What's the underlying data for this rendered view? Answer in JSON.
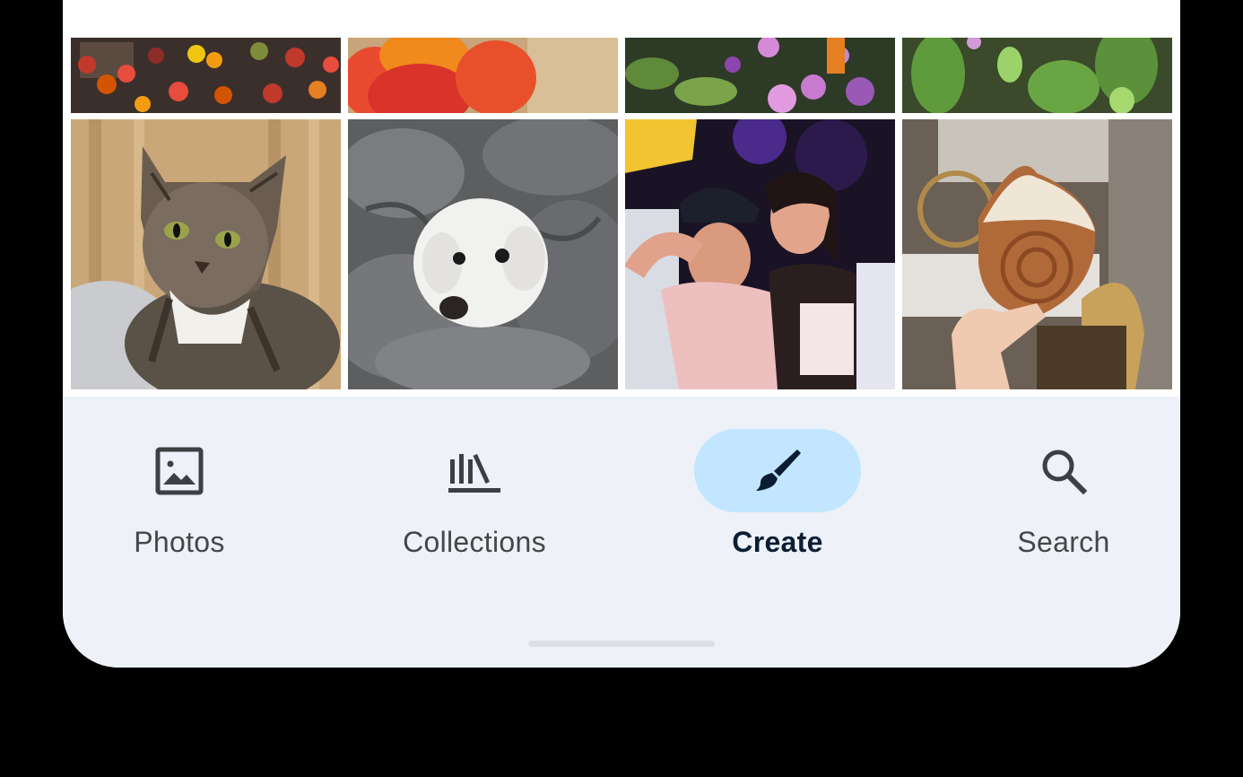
{
  "nav": {
    "items": [
      {
        "label": "Photos",
        "icon": "photo-icon",
        "active": false
      },
      {
        "label": "Collections",
        "icon": "collections-icon",
        "active": false
      },
      {
        "label": "Create",
        "icon": "brush-icon",
        "active": true
      },
      {
        "label": "Search",
        "icon": "search-icon",
        "active": false
      }
    ]
  },
  "colors": {
    "nav_background": "#eef1f8",
    "active_pill": "#c2e6ff",
    "active_label": "#0b1d33",
    "inactive_label": "#444746"
  }
}
